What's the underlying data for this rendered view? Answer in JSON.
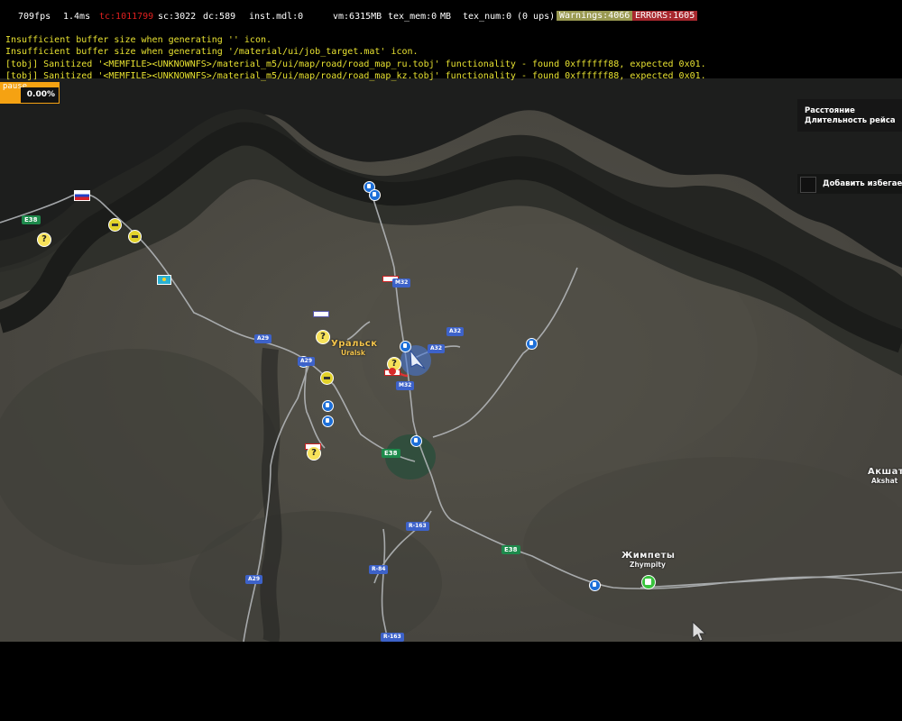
{
  "debug": {
    "fps": "709fps",
    "frame_time": "1.4ms",
    "tc": "tc:1011799",
    "sc": "sc:3022",
    "dc": "dc:589",
    "inst": "inst.mdl:0",
    "vm": "vm:6315MB",
    "tex_mem": "tex_mem:0",
    "tex_mem_unit": "MB",
    "tex_num": "tex_num:0",
    "ups": "(0 ups)",
    "warnings": "Warnings:4066",
    "errors": "ERRORS:1605",
    "colors": {
      "text": "#ffffff",
      "tc": "#e0201f",
      "warnings_bg": "#9a9a52",
      "errors_bg": "#a8282e"
    }
  },
  "console": [
    "Insufficient buffer size when generating '' icon.",
    "Insufficient buffer size when generating '/material/ui/job_target.mat' icon.",
    "[tobj] Sanitized '<MEMFILE><UNKNOWNFS>/material_m5/ui/map/road/road_map_ru.tobj' functionality - found 0xffffff88, expected 0x01.",
    "[tobj] Sanitized '<MEMFILE><UNKNOWNFS>/material_m5/ui/map/road/road_map_kz.tobj' functionality - found 0xffffff88, expected 0x01."
  ],
  "pause": {
    "label": "pause",
    "value": "0.00%"
  },
  "route_panel": {
    "distance_label": "Расстояние",
    "duration_label": "Длительность рейса"
  },
  "avoid": {
    "label": "Добавить избегаемое"
  },
  "cities": {
    "uralsk_ru": "Уральск",
    "uralsk_en": "Uralsk",
    "zhympity_ru": "Жимпеты",
    "zhympity_en": "Zhympity",
    "akshat_ru": "Акшат",
    "akshat_en": "Akshat"
  },
  "roads": {
    "e38_a": "E38",
    "e38_b": "E38",
    "e38_c": "E38",
    "a29_a": "A29",
    "a29_b": "A29",
    "a29_c": "A29",
    "a32_a": "A32",
    "a32_b": "A32",
    "m32_a": "M32",
    "m32_b": "M32",
    "r163_a": "R-163",
    "r163_b": "R-163",
    "r84": "R-84"
  },
  "icons": {
    "gas": "gas-station-icon",
    "quest": "question-mark-icon",
    "player": "player-arrow-icon",
    "cursor": "mouse-cursor-icon"
  }
}
